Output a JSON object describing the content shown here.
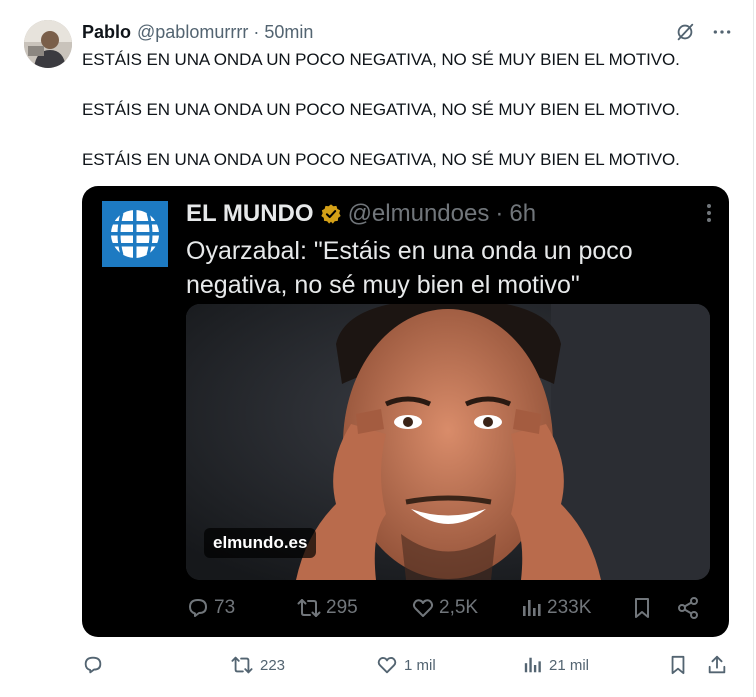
{
  "tweet": {
    "author_name": "Pablo",
    "author_handle": "@pablomurrrr",
    "separator": "·",
    "time": "50min",
    "lines": [
      "ESTÁIS EN UNA ONDA UN POCO NEGATIVA, NO SÉ MUY BIEN EL MOTIVO.",
      "ESTÁIS EN UNA ONDA UN POCO NEGATIVA, NO SÉ MUY BIEN EL MOTIVO.",
      "ESTÁIS EN UNA ONDA UN POCO NEGATIVA, NO SÉ MUY BIEN EL MOTIVO."
    ],
    "actions": {
      "reply_count": "",
      "retweet_count": "223",
      "like_count": "1 mil",
      "views_count": "21 mil"
    }
  },
  "quoted": {
    "author_name": "EL MUNDO",
    "author_handle": "@elmundoes",
    "separator": "·",
    "time": "6h",
    "text": "Oyarzabal: \"Estáis en una onda un poco negativa, no sé muy bien el motivo\"",
    "image_watermark": "elmundo.es",
    "actions": {
      "reply_count": "73",
      "retweet_count": "295",
      "like_count": "2,5K",
      "views_count": "233K"
    }
  },
  "icons": {
    "grok": "grok-icon",
    "more": "more-icon",
    "verified": "verified-badge-icon",
    "reply": "reply-icon",
    "retweet": "retweet-icon",
    "like": "heart-icon",
    "views": "views-icon",
    "bookmark": "bookmark-icon",
    "share": "share-icon"
  },
  "colors": {
    "text_primary": "#0f1419",
    "text_secondary": "#536471",
    "card_background": "#000000",
    "card_text": "#e7e9ea",
    "card_secondary": "#71767b",
    "verified_gold": "#d4a017",
    "logo_blue": "#1d7ac2"
  }
}
